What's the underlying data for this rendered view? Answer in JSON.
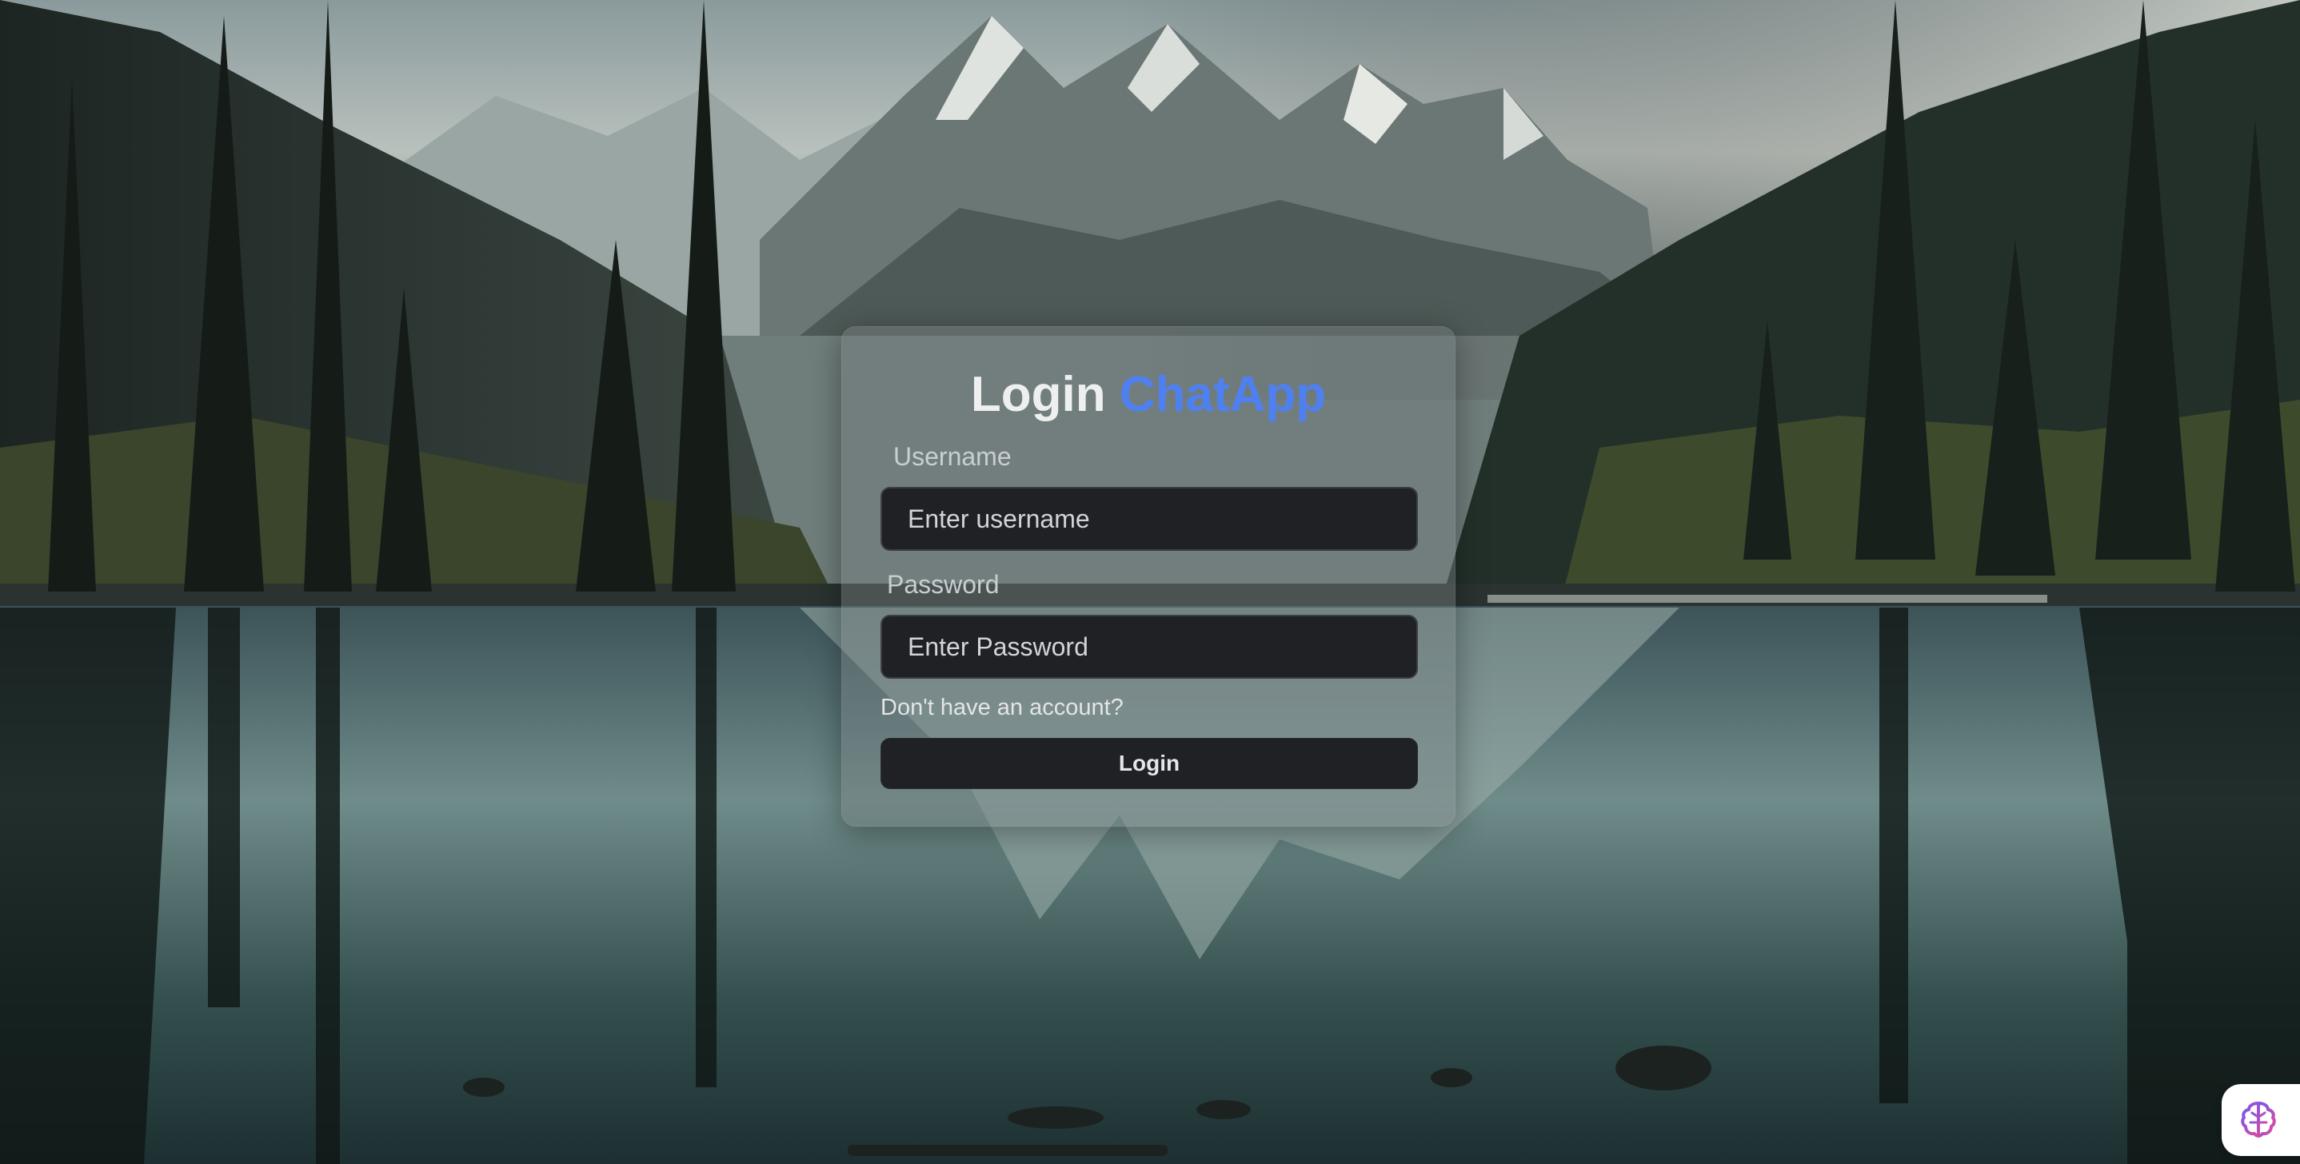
{
  "login_card": {
    "title_prefix": "Login",
    "title_accent": "ChatApp",
    "accent_color": "#4f80f2",
    "username_label": "Username",
    "username_placeholder": "Enter username",
    "password_label": "Password",
    "password_placeholder": "Enter Password",
    "signup_link": "Don't have an account?",
    "login_button": "Login"
  },
  "background": {
    "description_icon": "mountain-lake-landscape"
  },
  "extension_badge": {
    "icon": "brain-icon"
  }
}
